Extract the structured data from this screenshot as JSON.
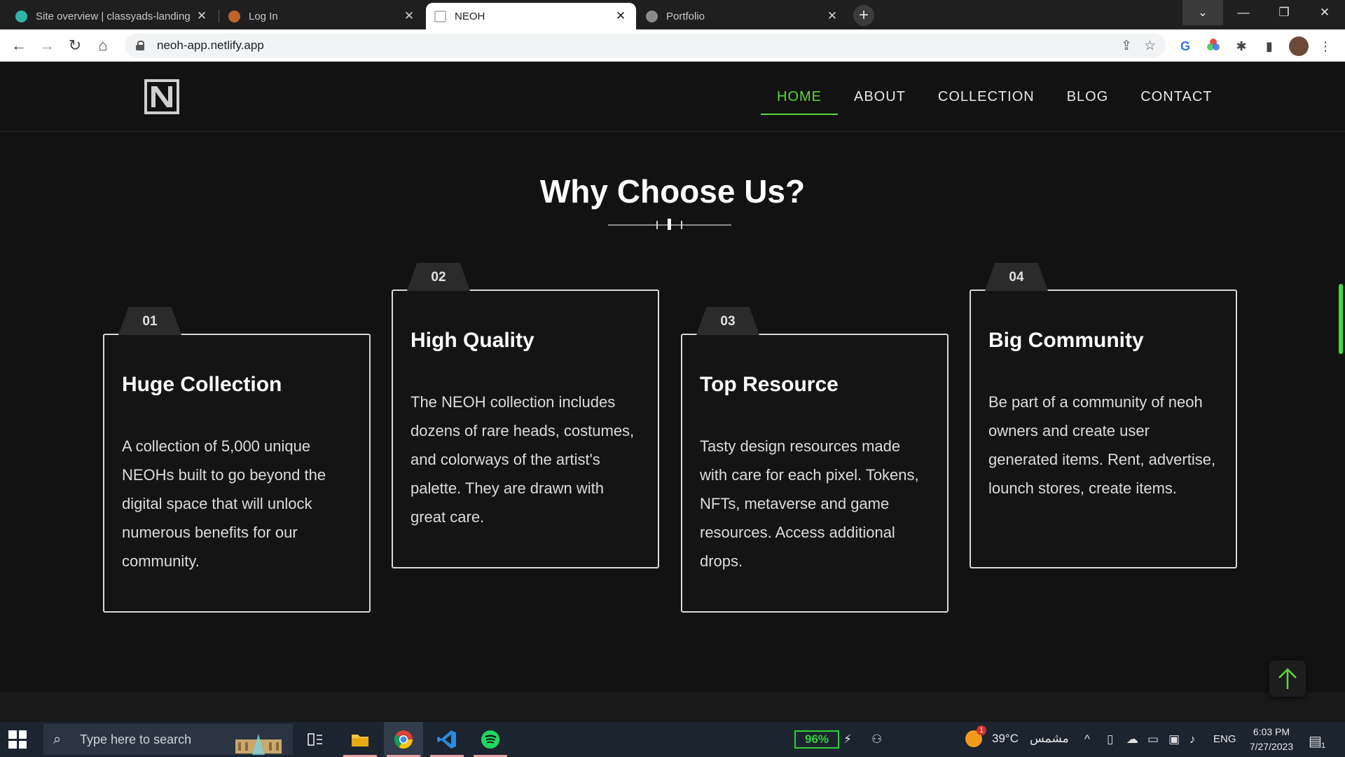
{
  "browser": {
    "tabs": [
      {
        "title": "Site overview | classyads-landing",
        "favicon_color": "#2fb5a8"
      },
      {
        "title": "Log In",
        "favicon_color": "#c0622a"
      },
      {
        "title": "NEOH",
        "favicon_color": "#bdbdbd"
      },
      {
        "title": "Portfolio",
        "favicon_color": "#8a8a8a"
      }
    ],
    "url": "neoh-app.netlify.app"
  },
  "site": {
    "nav": [
      "HOME",
      "ABOUT",
      "COLLECTION",
      "BLOG",
      "CONTACT"
    ],
    "active_nav": "HOME",
    "accent_color": "#5fd43a",
    "section_title": "Why Choose Us?",
    "cards": [
      {
        "number": "01",
        "title": "Huge Collection",
        "text": "A collection of 5,000 unique NEOHs built to go beyond the digital space that will unlock numerous benefits for our community."
      },
      {
        "number": "02",
        "title": "High Quality",
        "text": "The NEOH collection includes dozens of rare heads, costumes, and colorways of the artist's palette. They are drawn with great care."
      },
      {
        "number": "03",
        "title": "Top Resource",
        "text": "Tasty design resources made with care for each pixel. Tokens, NFTs, metaverse and game resources. Access additional drops."
      },
      {
        "number": "04",
        "title": "Big Community",
        "text": "Be part of a community of neoh owners and create user generated items. Rent, advertise, lounch stores, create items."
      }
    ]
  },
  "taskbar": {
    "search_placeholder": "Type here to search",
    "battery": "96%",
    "weather": "39°C",
    "weather_text": "مشمس",
    "weather_badge": "1",
    "language": "ENG",
    "time": "6:03 PM",
    "date": "7/27/2023",
    "notification_count": "1"
  }
}
